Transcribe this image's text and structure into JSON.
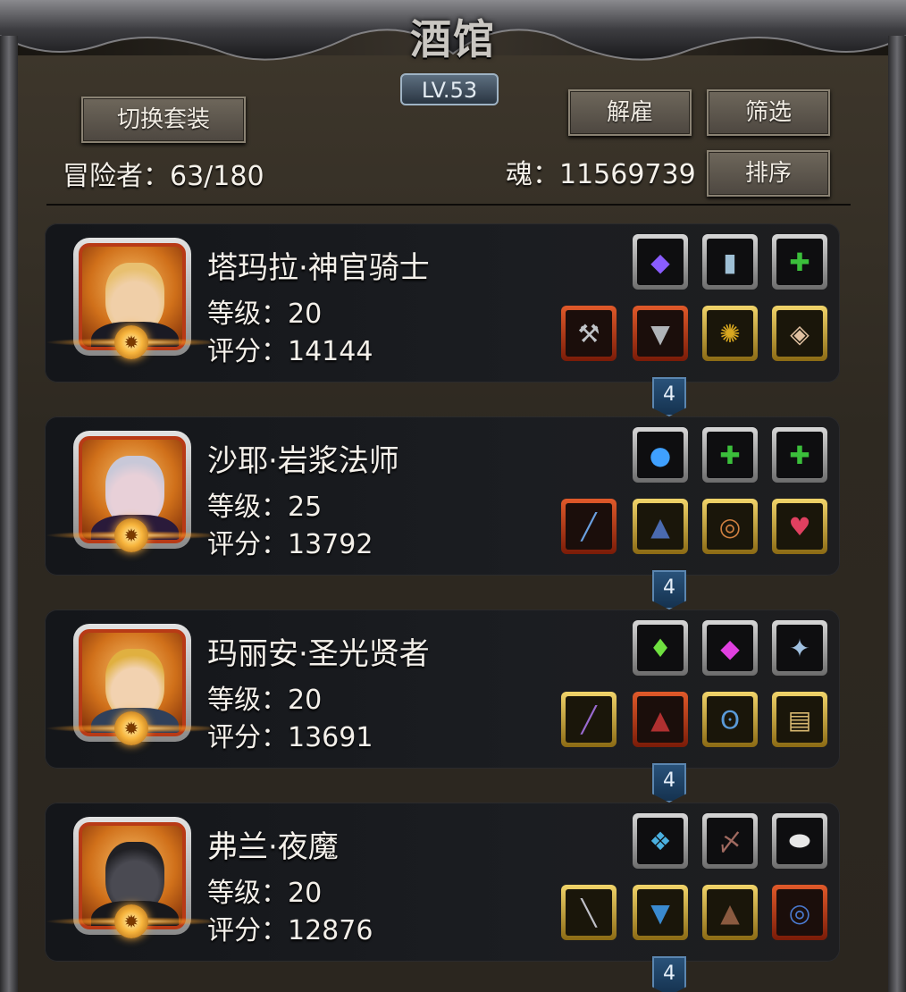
{
  "header": {
    "title": "酒馆",
    "level": "LV.53",
    "switch_outfit_label": "切换套装",
    "dismiss_label": "解雇",
    "filter_label": "筛选",
    "sort_label": "排序",
    "adventurers_text": "冒险者：63/180",
    "soul_text": "魂：11569739"
  },
  "heroes": [
    {
      "name": "塔玛拉·神官骑士",
      "level_text": "等级：20",
      "score_text": "评分：14144",
      "link_count": "4",
      "portrait_theme": "nun-priestess",
      "accessory_slots": [
        {
          "icon": "purple-gem-icon",
          "glyph": "◆",
          "color": "#8a5cff",
          "frame": "silver"
        },
        {
          "icon": "book-icon",
          "glyph": "▮",
          "color": "#9fc0d6",
          "frame": "silver"
        },
        {
          "icon": "empty-green-cross-icon",
          "glyph": "✚",
          "color": "#3bbf3b",
          "frame": "silver"
        }
      ],
      "gear_slots": [
        {
          "icon": "hammer-icon",
          "glyph": "⚒",
          "color": "#c0c4c8",
          "frame": "red"
        },
        {
          "icon": "armor-icon",
          "glyph": "▼",
          "color": "#b0b4b8",
          "frame": "red"
        },
        {
          "icon": "amulet-icon",
          "glyph": "✺",
          "color": "#d9a820",
          "frame": "gold"
        },
        {
          "icon": "scroll-icon",
          "glyph": "◈",
          "color": "#e0c0a0",
          "frame": "gold"
        }
      ]
    },
    {
      "name": "沙耶·岩浆法师",
      "level_text": "等级：25",
      "score_text": "评分：13792",
      "link_count": "4",
      "portrait_theme": "witch-mage",
      "accessory_slots": [
        {
          "icon": "blue-orb-icon",
          "glyph": "●",
          "color": "#3fa0ff",
          "frame": "silver"
        },
        {
          "icon": "empty-green-cross-icon",
          "glyph": "✚",
          "color": "#3bbf3b",
          "frame": "silver"
        },
        {
          "icon": "empty-green-cross-icon",
          "glyph": "✚",
          "color": "#3bbf3b",
          "frame": "silver"
        }
      ],
      "gear_slots": [
        {
          "icon": "staff-icon",
          "glyph": "╱",
          "color": "#6aa0e0",
          "frame": "red"
        },
        {
          "icon": "cloak-icon",
          "glyph": "▲",
          "color": "#4a6ab0",
          "frame": "gold"
        },
        {
          "icon": "ring-icon",
          "glyph": "◎",
          "color": "#d08040",
          "frame": "gold"
        },
        {
          "icon": "heart-pendant-icon",
          "glyph": "♥",
          "color": "#e04060",
          "frame": "gold"
        }
      ]
    },
    {
      "name": "玛丽安·圣光贤者",
      "level_text": "等级：20",
      "score_text": "评分：13691",
      "link_count": "4",
      "portrait_theme": "blonde-sage",
      "accessory_slots": [
        {
          "icon": "green-crystal-icon",
          "glyph": "♦",
          "color": "#6fe040",
          "frame": "silver"
        },
        {
          "icon": "magenta-gem-icon",
          "glyph": "◆",
          "color": "#e040e0",
          "frame": "silver"
        },
        {
          "icon": "star-emblem-icon",
          "glyph": "✦",
          "color": "#a0c0e0",
          "frame": "silver"
        }
      ],
      "gear_slots": [
        {
          "icon": "scepter-icon",
          "glyph": "╱",
          "color": "#9a6ad0",
          "frame": "gold"
        },
        {
          "icon": "robe-icon",
          "glyph": "▲",
          "color": "#b03030",
          "frame": "red"
        },
        {
          "icon": "necklace-icon",
          "glyph": "ʘ",
          "color": "#5a9ad8",
          "frame": "gold"
        },
        {
          "icon": "parchment-icon",
          "glyph": "▤",
          "color": "#d8b870",
          "frame": "gold"
        }
      ]
    },
    {
      "name": "弗兰·夜魔",
      "level_text": "等级：20",
      "score_text": "评分：12876",
      "link_count": "4",
      "portrait_theme": "masked-ninja",
      "accessory_slots": [
        {
          "icon": "blue-relic-icon",
          "glyph": "❖",
          "color": "#4ab0e0",
          "frame": "silver"
        },
        {
          "icon": "feather-icon",
          "glyph": "〆",
          "color": "#a06a60",
          "frame": "silver"
        },
        {
          "icon": "white-stone-icon",
          "glyph": "⬬",
          "color": "#e8e8e8",
          "frame": "silver"
        }
      ],
      "gear_slots": [
        {
          "icon": "dagger-icon",
          "glyph": "╲",
          "color": "#c0c0c8",
          "frame": "gold"
        },
        {
          "icon": "leather-armor-icon",
          "glyph": "▼",
          "color": "#3a8ad0",
          "frame": "gold"
        },
        {
          "icon": "cape-icon",
          "glyph": "▲",
          "color": "#8a5a40",
          "frame": "gold"
        },
        {
          "icon": "bracelet-icon",
          "glyph": "◎",
          "color": "#4a7ad0",
          "frame": "red"
        }
      ]
    }
  ]
}
